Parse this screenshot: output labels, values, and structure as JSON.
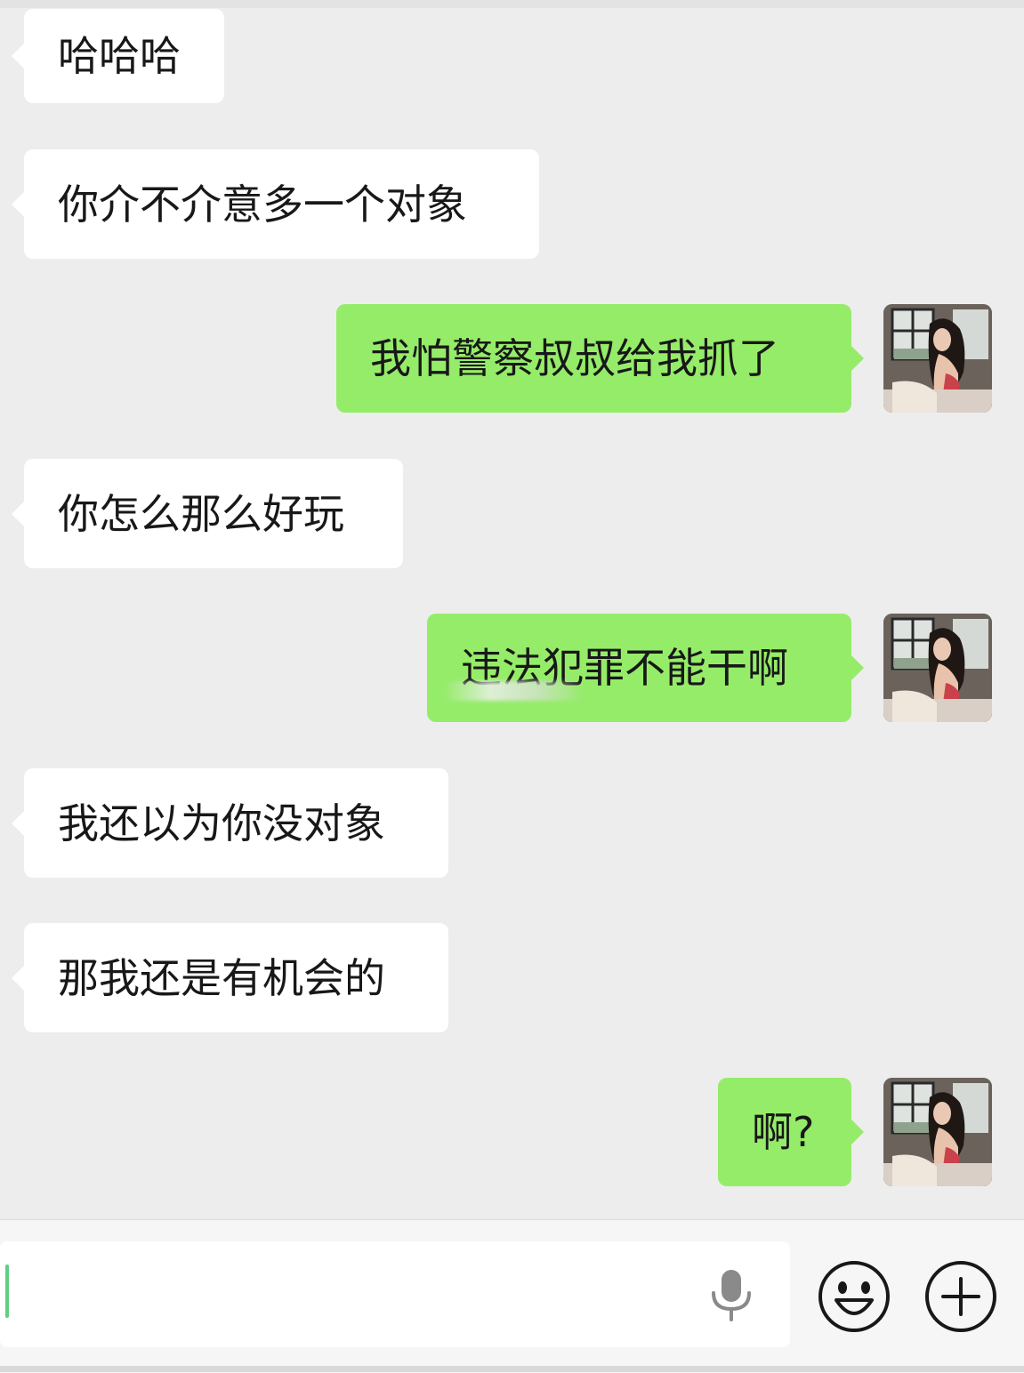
{
  "messages": [
    {
      "side": "in",
      "text": "哈哈哈"
    },
    {
      "side": "in",
      "text": "你介不介意多一个对象"
    },
    {
      "side": "out",
      "text": "我怕警察叔叔给我抓了"
    },
    {
      "side": "in",
      "text": "你怎么那么好玩"
    },
    {
      "side": "out",
      "text": "违法犯罪不能干啊"
    },
    {
      "side": "in",
      "text": "我还以为你没对象"
    },
    {
      "side": "in",
      "text": "那我还是有机会的"
    },
    {
      "side": "out",
      "text": "啊?"
    }
  ],
  "input": {
    "value": "",
    "placeholder": ""
  },
  "icons": {
    "voice": "microphone-icon",
    "emoji": "smiley-face-icon",
    "more": "plus-circle-icon"
  },
  "colors": {
    "background": "#ededed",
    "incoming_bubble": "#ffffff",
    "outgoing_bubble": "#95ec69",
    "text": "#181818"
  }
}
